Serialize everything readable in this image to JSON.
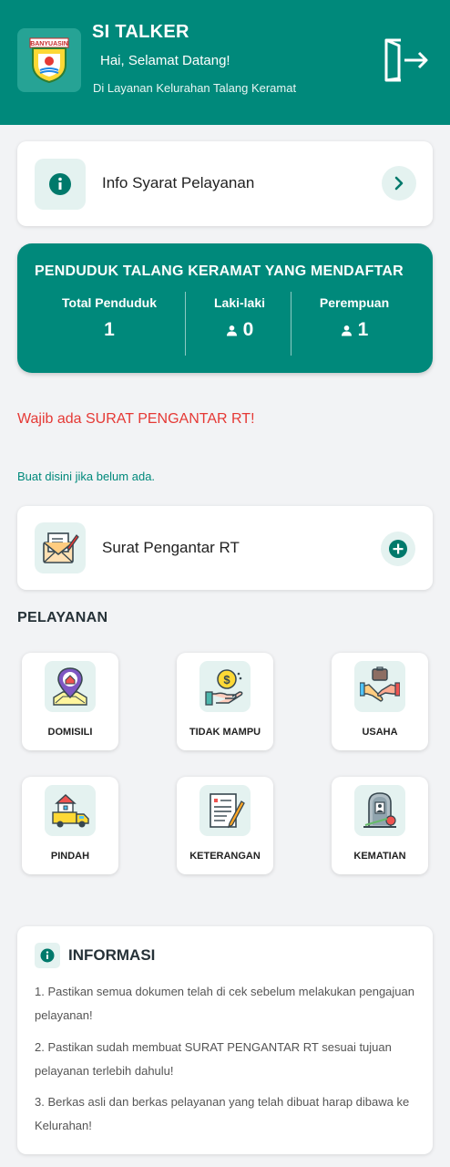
{
  "header": {
    "title": "SI TALKER",
    "greeting": "Hai, Selamat Datang!",
    "subtitle": "Di Layanan Kelurahan Talang Keramat",
    "logo_text": "BANYUASIN",
    "logout_icon": "logout-icon"
  },
  "info_syarat": {
    "label": "Info Syarat Pelayanan",
    "icon": "info-icon",
    "action_icon": "chevron-right-icon"
  },
  "stats": {
    "title": "PENDUDUK TALANG KERAMAT YANG MENDAFTAR",
    "columns": [
      {
        "label": "Total Penduduk",
        "value": "1"
      },
      {
        "label": "Laki-laki",
        "value": "0",
        "icon": "person-icon"
      },
      {
        "label": "Perempuan",
        "value": "1",
        "icon": "person-icon"
      }
    ]
  },
  "warning": "Wajib ada SURAT PENGANTAR RT!",
  "create_link": "Buat disini jika belum ada.",
  "surat_rt": {
    "label": "Surat Pengantar RT",
    "icon": "letter-pen-icon",
    "action_icon": "plus-circle-icon"
  },
  "pelayanan": {
    "title": "PELAYANAN",
    "items": [
      {
        "label": "DOMISILI",
        "icon": "location-home-icon"
      },
      {
        "label": "TIDAK MAMPU",
        "icon": "coin-hand-icon"
      },
      {
        "label": "USAHA",
        "icon": "handshake-icon"
      },
      {
        "label": "PINDAH",
        "icon": "moving-truck-icon"
      },
      {
        "label": "KETERANGAN",
        "icon": "document-pen-icon"
      },
      {
        "label": "KEMATIAN",
        "icon": "gravestone-icon"
      }
    ]
  },
  "informasi": {
    "title": "INFORMASI",
    "items": [
      "1. Pastikan semua dokumen telah di cek sebelum melakukan pengajuan pelayanan!",
      "2. Pastikan sudah membuat SURAT PENGANTAR RT sesuai tujuan pelayanan terlebih dahulu!",
      "3. Berkas asli dan berkas pelayanan yang telah dibuat harap dibawa ke Kelurahan!"
    ]
  },
  "colors": {
    "primary": "#00897b",
    "tile_bg": "#e4f2f0",
    "warning": "#e53935"
  }
}
